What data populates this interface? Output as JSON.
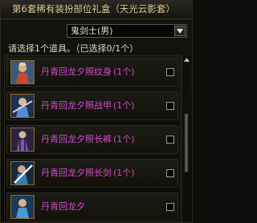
{
  "dialog": {
    "title": "第6套稀有装扮部位礼盒（天光云影套）",
    "character_select": {
      "value": "鬼剑士(男)"
    },
    "hint": "请选择1个道具。（已选择0/1个）"
  },
  "items": [
    {
      "name": "丹青回龙夕照纹身",
      "count": "(1个)",
      "checked": false,
      "icon": "character-portrait-icon"
    },
    {
      "name": "丹青回龙夕照战甲",
      "count": "(1个)",
      "checked": false,
      "icon": "character-portrait-icon"
    },
    {
      "name": "丹青回龙夕照长裤",
      "count": "(1个)",
      "checked": false,
      "icon": "character-portrait-icon"
    },
    {
      "name": "丹青回龙夕照长剑",
      "count": "(1个)",
      "checked": false,
      "icon": "character-portrait-icon"
    },
    {
      "name": "丹青回龙夕",
      "count": "",
      "checked": false,
      "icon": "character-portrait-icon"
    }
  ],
  "colors": {
    "title": "#e6d29a",
    "item_text": "#d24ccf",
    "background": "#0c0c0a"
  }
}
